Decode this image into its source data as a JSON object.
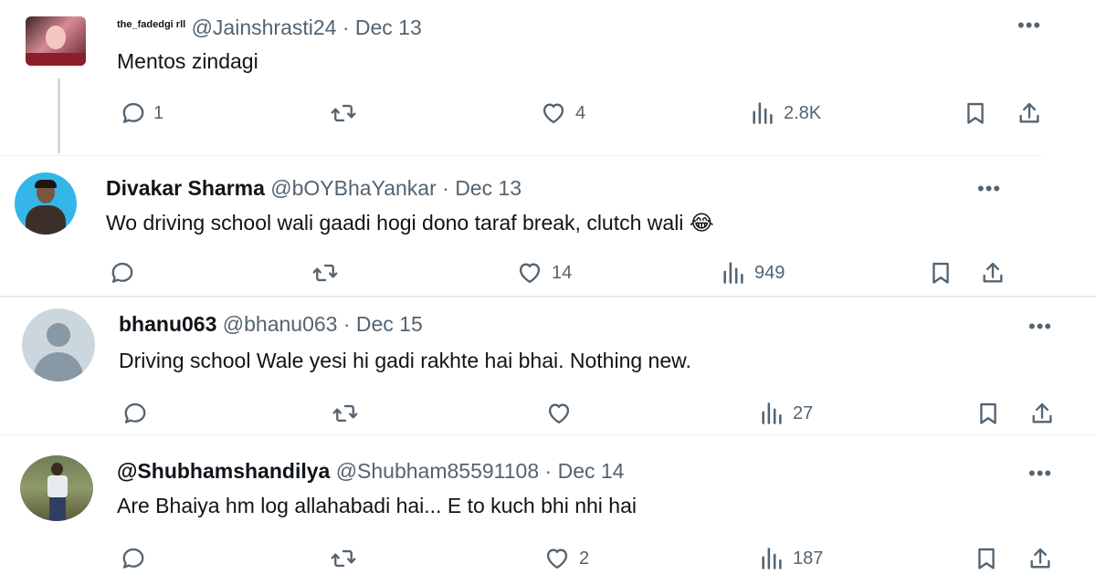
{
  "tweets": [
    {
      "name": "the_fadedgi rll",
      "handle": "@Jainshrasti24",
      "date": "· Dec 13",
      "text": "Mentos zindagi",
      "replies": "1",
      "retweets": "",
      "likes": "4",
      "views": "2.8K"
    },
    {
      "name": "Divakar Sharma",
      "handle": "@bOYBhaYankar",
      "date": "· Dec 13",
      "text": "Wo driving school wali gaadi hogi dono taraf break, clutch wali 😂",
      "replies": "",
      "retweets": "",
      "likes": "14",
      "views": "949"
    },
    {
      "name": "bhanu063",
      "handle": "@bhanu063",
      "date": "· Dec 15",
      "text": "Driving school Wale yesi hi gadi rakhte hai bhai. Nothing new.",
      "replies": "",
      "retweets": "",
      "likes": "",
      "views": "27"
    },
    {
      "name": "@Shubhamshandilya",
      "handle": "@Shubham85591108",
      "date": "· Dec 14",
      "text": "Are Bhaiya hm log allahabadi hai... E to kuch bhi nhi hai",
      "replies": "",
      "retweets": "",
      "likes": "2",
      "views": "187"
    }
  ],
  "more_label": "•••",
  "icons": {
    "reply": "reply-icon",
    "retweet": "retweet-icon",
    "like": "like-icon",
    "views": "views-icon",
    "bookmark": "bookmark-icon",
    "share": "share-icon"
  },
  "colors": {
    "text": "#0f1419",
    "secondary": "#536471",
    "divider": "#e6e9ec"
  }
}
